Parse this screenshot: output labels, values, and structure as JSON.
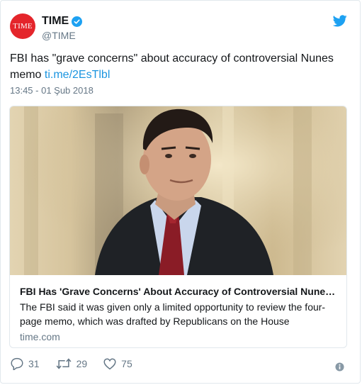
{
  "author": {
    "avatar_text": "TIME",
    "display_name": "TIME",
    "handle": "@TIME",
    "avatar_color": "#e4252b"
  },
  "tweet": {
    "text": "FBI has \"grave concerns\" about accuracy of controversial Nunes memo ",
    "link": "ti.me/2EsTlbl",
    "timestamp": "13:45 - 01 Şub 2018"
  },
  "card": {
    "title": "FBI Has 'Grave Concerns' About Accuracy of Controversial Nunes Memo",
    "description": "The FBI said it was given only a limited opportunity to review the four-page memo, which was drafted by Republicans on the House",
    "domain": "time.com"
  },
  "actions": {
    "replies": "31",
    "retweets": "29",
    "likes": "75"
  },
  "icons": {
    "verified": "verified-badge-icon",
    "logo": "twitter-bird-icon",
    "reply": "reply-icon",
    "retweet": "retweet-icon",
    "like": "heart-icon",
    "info": "info-icon"
  },
  "colors": {
    "twitter_blue": "#1da1f2",
    "link": "#1b95e0",
    "secondary_text": "#657786"
  }
}
